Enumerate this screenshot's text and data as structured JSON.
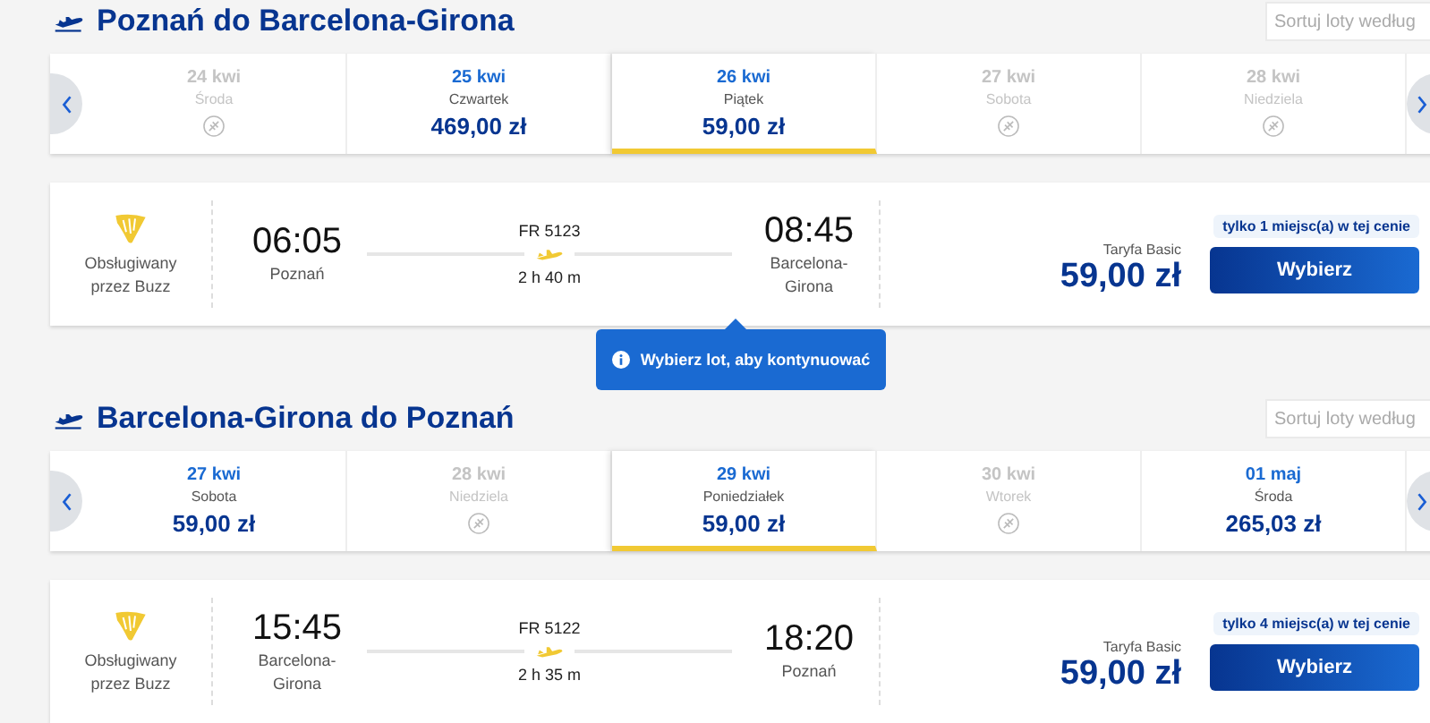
{
  "sections": [
    {
      "title": "Poznań do Barcelona-Girona",
      "sort": {
        "placeholder": "Sortuj loty według"
      },
      "days": [
        {
          "kind": "no_flight",
          "date": "24 kwi",
          "weekday": "Środa",
          "selected": false
        },
        {
          "kind": "price",
          "date": "25 kwi",
          "weekday": "Czwartek",
          "price": "469,00 zł",
          "selected": false
        },
        {
          "kind": "price",
          "date": "26 kwi",
          "weekday": "Piątek",
          "price": "59,00 zł",
          "selected": true
        },
        {
          "kind": "no_flight",
          "date": "27 kwi",
          "weekday": "Sobota",
          "selected": false
        },
        {
          "kind": "no_flight",
          "date": "28 kwi",
          "weekday": "Niedziela",
          "selected": false
        }
      ],
      "flight": {
        "operator": "Obsługiwany przez Buzz",
        "departure_time": "06:05",
        "departure_city": "Poznań",
        "flight_number": "FR 5123",
        "duration": "2 h 40 m",
        "arrival_time": "08:45",
        "arrival_city": "Barcelona-Girona",
        "fare": "Taryfa Basic",
        "price": "59,00 zł",
        "seats": "tylko 1 miejsc(a) w tej cenie",
        "button": "Wybierz"
      },
      "tooltip": "Wybierz lot, aby kontynuować"
    },
    {
      "title": "Barcelona-Girona do Poznań",
      "sort": {
        "placeholder": "Sortuj loty według"
      },
      "days": [
        {
          "kind": "price",
          "date": "27 kwi",
          "weekday": "Sobota",
          "price": "59,00 zł",
          "selected": false
        },
        {
          "kind": "no_flight",
          "date": "28 kwi",
          "weekday": "Niedziela",
          "selected": false
        },
        {
          "kind": "price",
          "date": "29 kwi",
          "weekday": "Poniedziałek",
          "price": "59,00 zł",
          "selected": true
        },
        {
          "kind": "no_flight",
          "date": "30 kwi",
          "weekday": "Wtorek",
          "selected": false
        },
        {
          "kind": "price",
          "date": "01 maj",
          "weekday": "Środa",
          "price": "265,03 zł",
          "selected": false
        }
      ],
      "flight": {
        "operator": "Obsługiwany przez Buzz",
        "departure_time": "15:45",
        "departure_city": "Barcelona-Girona",
        "flight_number": "FR 5122",
        "duration": "2 h 35 m",
        "arrival_time": "18:20",
        "arrival_city": "Poznań",
        "fare": "Taryfa Basic",
        "price": "59,00 zł",
        "seats": "tylko 4 miejsc(a) w tej cenie",
        "button": "Wybierz"
      }
    }
  ]
}
